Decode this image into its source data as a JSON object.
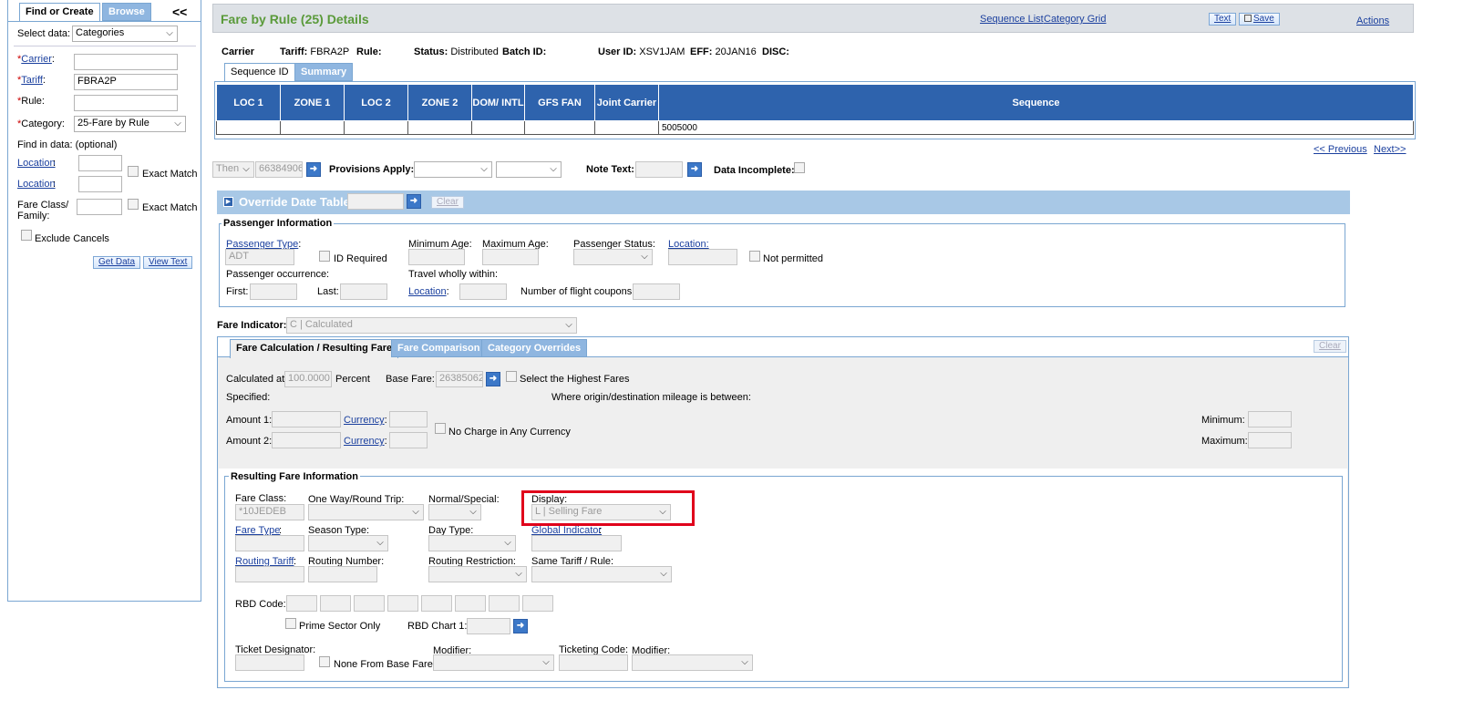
{
  "sidebar": {
    "tabs": {
      "find": "Find or Create",
      "browse": "Browse",
      "collapse": "<<"
    },
    "select_data_label": "Select data:",
    "select_data_value": "Categories",
    "carrier_label": "Carrier",
    "tariff_label": "Tariff",
    "tariff_value": "FBRA2P",
    "rule_label": "Rule:",
    "category_label": "Category:",
    "category_value": "25-Fare by Rule",
    "find_in_data": "Find in data: (optional)",
    "location_label": "Location",
    "exact_match": "Exact Match",
    "fare_class_family": "Fare Class/ Family:",
    "exclude_cancels": "Exclude Cancels",
    "get_data": "Get Data",
    "view_text": "View Text"
  },
  "header": {
    "title": "Fare by Rule (25) Details",
    "sequence_list": "Sequence List",
    "category_grid": "Category Grid",
    "text_btn": "Text",
    "save_btn": "Save",
    "actions": "Actions"
  },
  "info": {
    "carrier": "Carrier",
    "tariff_label": "Tariff:",
    "tariff": "FBRA2P",
    "rule": "Rule:",
    "status_label": "Status:",
    "status": "Distributed",
    "batch": "Batch ID:",
    "user_label": "User ID:",
    "user": "XSV1JAM",
    "eff_label": "EFF:",
    "eff": "20JAN16",
    "disc": "DISC:"
  },
  "seq_tabs": {
    "sequence_id": "Sequence ID",
    "summary": "Summary"
  },
  "seq_table": {
    "headers": [
      "LOC 1",
      "ZONE 1",
      "LOC 2",
      "ZONE 2",
      "DOM/ INTL",
      "GFS FAN",
      "Joint Carrier",
      "Sequence"
    ],
    "sequence_value": "5005000"
  },
  "pager": {
    "previous": "<< Previous",
    "next": "Next>>"
  },
  "provisions": {
    "then_value": "Then",
    "then_number": "66384906",
    "provisions_apply": "Provisions Apply:",
    "note_text": "Note Text:",
    "data_incomplete": "Data Incomplete:"
  },
  "override": {
    "title": "Override Date Table:",
    "clear": "Clear"
  },
  "passenger": {
    "legend": "Passenger Information",
    "passenger_type": "Passenger Type",
    "passenger_type_value": "ADT",
    "id_required": "ID Required",
    "min_age": "Minimum Age:",
    "max_age": "Maximum Age:",
    "passenger_status": "Passenger Status:",
    "location": "Location:",
    "not_permitted": "Not permitted",
    "occurrence": "Passenger occurrence:",
    "travel_within": "Travel wholly within:",
    "first": "First:",
    "last": "Last:",
    "location2": "Location",
    "flight_coupons": "Number of flight coupons:"
  },
  "fare_indicator": {
    "label": "Fare Indicator:",
    "value": "C | Calculated"
  },
  "calc_tabs": {
    "calc": "Fare Calculation / Resulting Fare",
    "comparison": "Fare Comparison",
    "overrides": "Category Overrides",
    "clear": "Clear"
  },
  "calc": {
    "calculated_at": "Calculated at",
    "percent_value": "100.0000",
    "percent": "Percent",
    "base_fare": "Base Fare:",
    "base_fare_value": "26385062",
    "select_highest": "Select the Highest Fares",
    "specified": "Specified:",
    "mileage": "Where origin/destination mileage is between:",
    "amount1": "Amount 1:",
    "amount2": "Amount 2:",
    "currency": "Currency",
    "no_charge": "No Charge in Any Currency",
    "minimum": "Minimum:",
    "maximum": "Maximum:"
  },
  "resulting": {
    "legend": "Resulting Fare Information",
    "fare_class": "Fare Class:",
    "fare_class_value": "*10JEDEB",
    "ow_rt": "One Way/Round Trip:",
    "normal_special": "Normal/Special:",
    "display": "Display:",
    "display_value": "L | Selling Fare",
    "fare_type": "Fare Type",
    "season_type": "Season Type:",
    "day_type": "Day Type:",
    "global_indicator": "Global Indicator",
    "routing_tariff": "Routing Tariff",
    "routing_number": "Routing Number:",
    "routing_restriction": "Routing Restriction:",
    "same_tariff_rule": "Same Tariff / Rule:",
    "rbd_code": "RBD Code:",
    "prime_sector": "Prime Sector Only",
    "rbd_chart": "RBD Chart 1:",
    "ticket_designator": "Ticket Designator:",
    "none_from_base": "None From Base Fare",
    "modifier": "Modifier:",
    "ticketing_code": "Ticketing Code:",
    "modifier2": "Modifier:"
  },
  "colors": {
    "highlight": "#e0001b",
    "header_bar": "#2e63ad",
    "accent": "#5a9a3a"
  }
}
